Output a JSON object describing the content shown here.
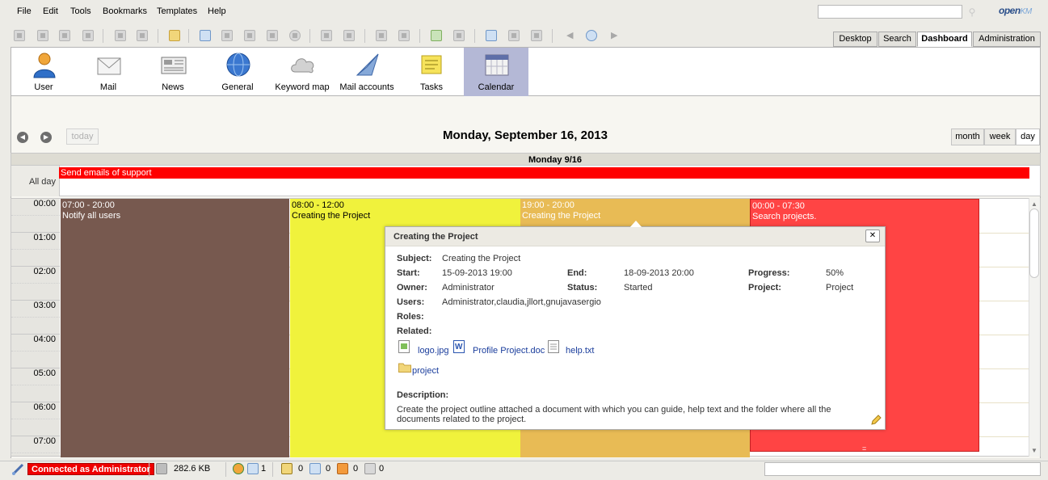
{
  "menu": [
    "File",
    "Edit",
    "Tools",
    "Bookmarks",
    "Templates",
    "Help"
  ],
  "search": {
    "placeholder": ""
  },
  "logo": {
    "main": "open",
    "suffix": "KM"
  },
  "workspace_tabs": [
    {
      "label": "Desktop",
      "active": false
    },
    {
      "label": "Search",
      "active": false
    },
    {
      "label": "Dashboard",
      "active": true
    },
    {
      "label": "Administration",
      "active": false
    }
  ],
  "dashboard_tools": [
    {
      "label": "User",
      "icon": "user-icon"
    },
    {
      "label": "Mail",
      "icon": "mail-icon"
    },
    {
      "label": "News",
      "icon": "news-icon"
    },
    {
      "label": "General",
      "icon": "globe-icon"
    },
    {
      "label": "Keyword map",
      "icon": "cloud-icon"
    },
    {
      "label": "Mail accounts",
      "icon": "mail-accounts-icon"
    },
    {
      "label": "Tasks",
      "icon": "tasks-icon"
    },
    {
      "label": "Calendar",
      "icon": "calendar-icon",
      "active": true
    }
  ],
  "calendar": {
    "today_label": "today",
    "title": "Monday, September 16, 2013",
    "views": [
      {
        "label": "month",
        "active": false
      },
      {
        "label": "week",
        "active": false
      },
      {
        "label": "day",
        "active": true
      }
    ],
    "day_header": "Monday 9/16",
    "all_day_label": "All day",
    "all_day_event": "Send emails of support",
    "hours": [
      "00:00",
      "01:00",
      "02:00",
      "03:00",
      "04:00",
      "05:00",
      "06:00",
      "07:00"
    ],
    "events": [
      {
        "time": "07:00 - 20:00",
        "title": "Notify all users",
        "color": "#77594f",
        "text_color": "#ffffff"
      },
      {
        "time": "08:00 - 12:00",
        "title": "Creating the Project",
        "color": "#f0f23c",
        "text_color": "#000000"
      },
      {
        "time": "19:00 - 20:00",
        "title": "Creating the Project",
        "color": "#e8bb55",
        "text_color": "#ffffff"
      },
      {
        "time": "00:00 - 07:30",
        "title": "Search projects.",
        "color": "#ff4444",
        "text_color": "#ffffff"
      }
    ]
  },
  "popup": {
    "title": "Creating the Project",
    "labels": {
      "subject": "Subject:",
      "start": "Start:",
      "end": "End:",
      "progress": "Progress:",
      "owner": "Owner:",
      "status": "Status:",
      "project": "Project:",
      "users": "Users:",
      "roles": "Roles:",
      "related": "Related:",
      "description": "Description:"
    },
    "subject": "Creating the Project",
    "start": "15-09-2013 19:00",
    "end": "18-09-2013 20:00",
    "progress": "50%",
    "owner": "Administrator",
    "status": "Started",
    "project": "Project",
    "users": "Administrator,claudia,jllort,gnujavasergio",
    "roles": "",
    "related": [
      "logo.jpg",
      "Profile Project.doc",
      "help.txt",
      "project"
    ],
    "description": "Create the project outline attached a document with which you can guide, help text and the folder where all the documents related to the project."
  },
  "status_bar": {
    "connection": "Connected as Administrator",
    "size": "282.6 KB",
    "users_count": "1",
    "locked_count": "0",
    "checkout_count": "0",
    "mail_count": "0",
    "subscribed_count": "0"
  }
}
